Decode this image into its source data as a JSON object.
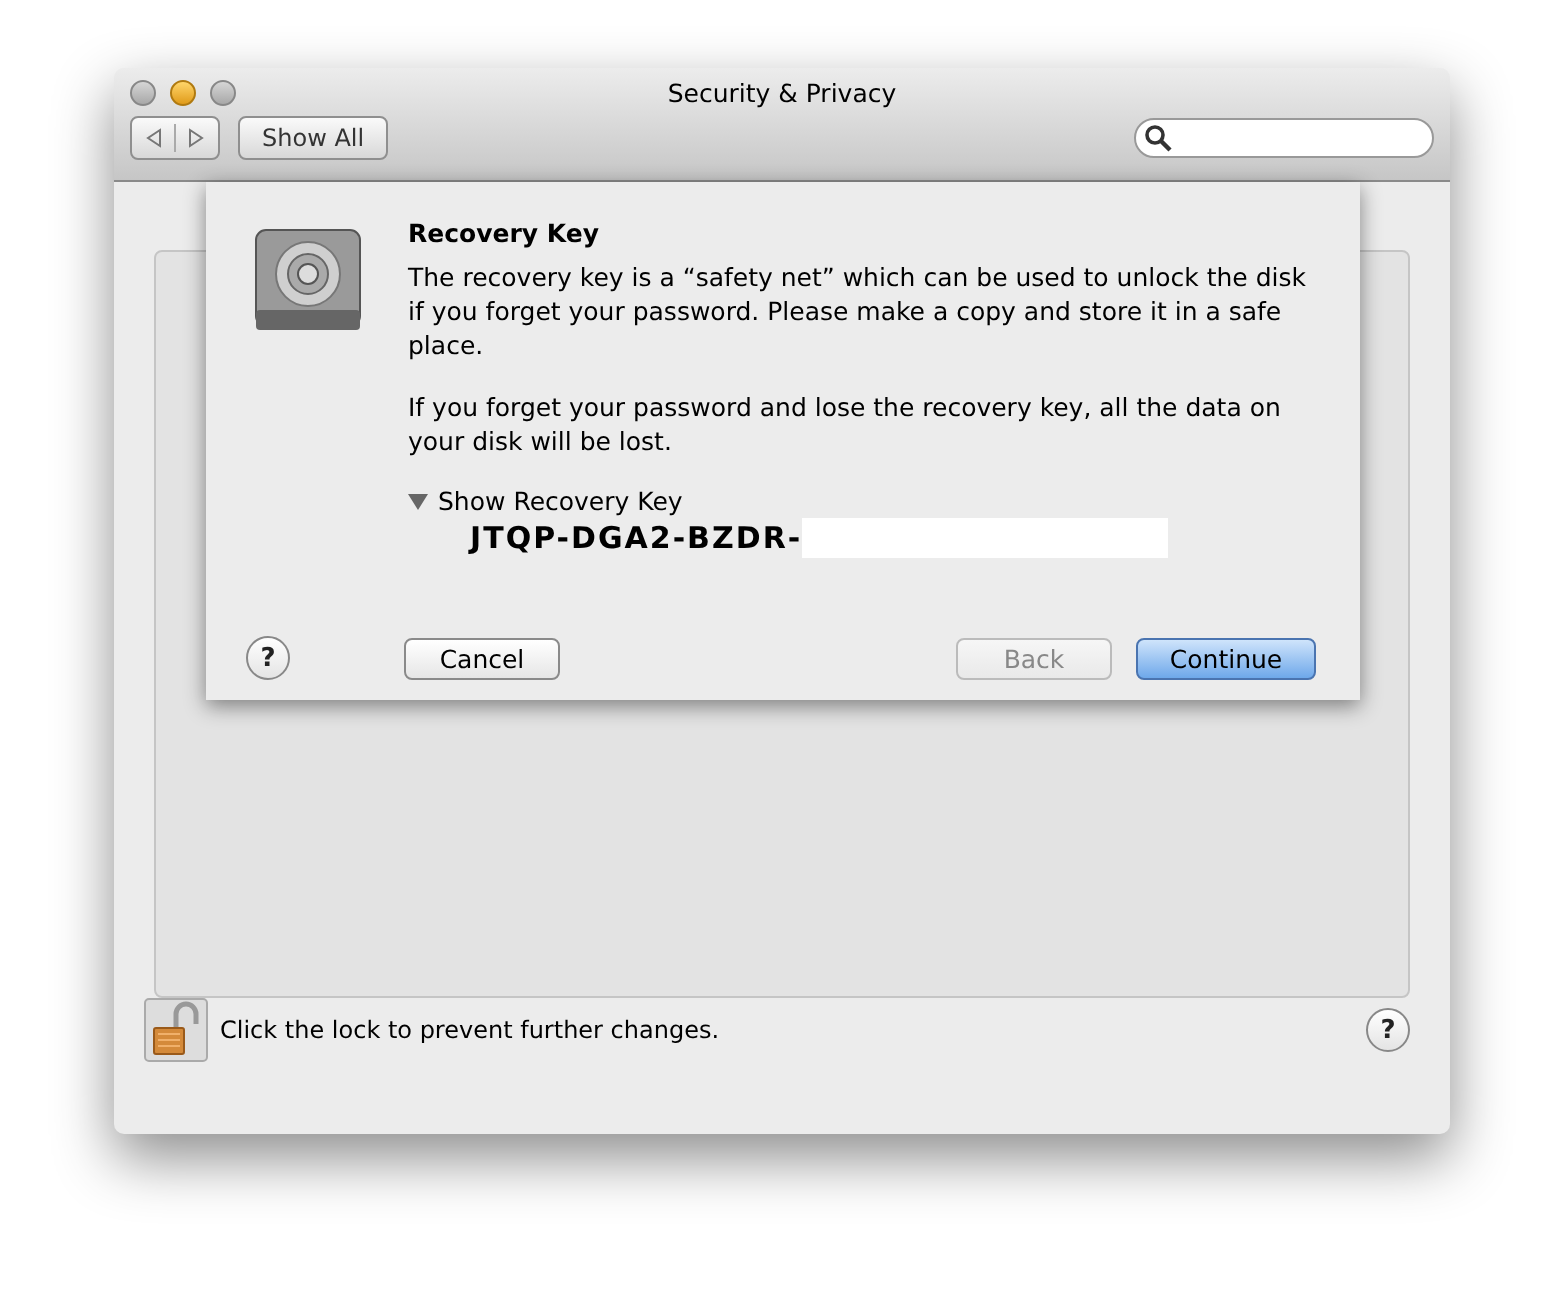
{
  "window": {
    "title": "Security & Privacy"
  },
  "toolbar": {
    "show_all": "Show All"
  },
  "sheet": {
    "title": "Recovery Key",
    "paragraphs": [
      "The recovery key is a “safety net” which can be used to unlock the disk if you forget your password. Please make a copy and store it in a safe place.",
      "If you forget your password and lose the recovery key, all the data on your disk will be lost."
    ],
    "disclosure": {
      "label": "Show Recovery Key",
      "expanded": true
    },
    "recovery_key": "JTQP-DGA2-BZDR-",
    "help": "?",
    "buttons": [
      {
        "label": "Cancel",
        "kind": "normal",
        "disabled": false
      },
      {
        "label": "Back",
        "kind": "normal",
        "disabled": true
      },
      {
        "label": "Continue",
        "kind": "default",
        "disabled": false
      }
    ]
  },
  "footer": {
    "lock_text": "Click the lock to prevent further changes.",
    "help": "?"
  }
}
